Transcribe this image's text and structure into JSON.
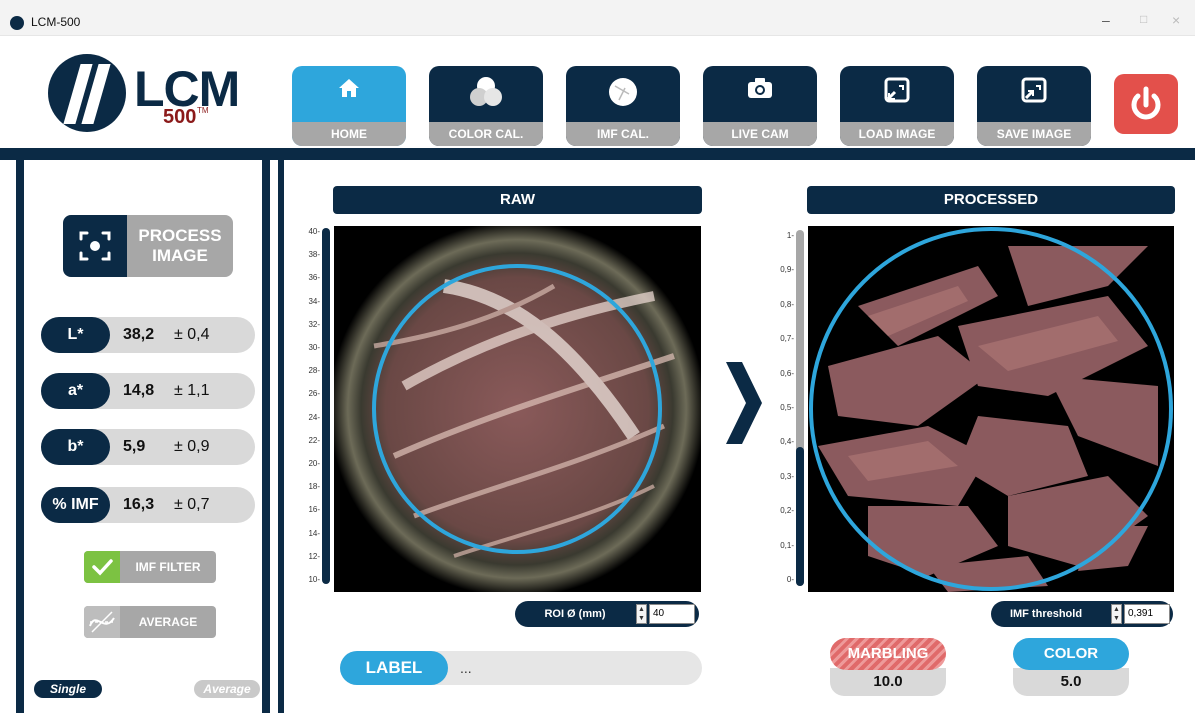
{
  "window": {
    "title": "LCM-500"
  },
  "logo": {
    "brand": "LCM",
    "model": "500",
    "tm": "TM"
  },
  "toolbar": {
    "home": "HOME",
    "color_cal": "COLOR CAL.",
    "imf_cal": "IMF CAL.",
    "live_cam": "LIVE CAM",
    "load_image": "LOAD IMAGE",
    "save_image": "SAVE IMAGE"
  },
  "left": {
    "process_line1": "PROCESS",
    "process_line2": "IMAGE",
    "measurements": [
      {
        "key": "L*",
        "value": "38,2",
        "pm": "± 0,4"
      },
      {
        "key": "a*",
        "value": "14,8",
        "pm": "± 1,1"
      },
      {
        "key": "b*",
        "value": "5,9",
        "pm": "± 0,9"
      },
      {
        "key": "% IMF",
        "value": "16,3",
        "pm": "± 0,7"
      }
    ],
    "imf_filter": "IMF FILTER",
    "average": "AVERAGE",
    "mode_single": "Single",
    "mode_average": "Average"
  },
  "raw": {
    "header": "RAW",
    "scale": [
      "40",
      "38",
      "36",
      "34",
      "32",
      "30",
      "28",
      "26",
      "24",
      "22",
      "20",
      "18",
      "16",
      "14",
      "12",
      "10"
    ],
    "roi_label": "ROI Ø (mm)",
    "roi_value": "40"
  },
  "processed": {
    "header": "PROCESSED",
    "scale": [
      "1",
      "0,9",
      "0,8",
      "0,7",
      "0,6",
      "0,5",
      "0,4",
      "0,3",
      "0,2",
      "0,1",
      "0"
    ],
    "threshold_label": "IMF threshold",
    "threshold_value": "0,391",
    "slider_level": 0.39
  },
  "label": {
    "key": "LABEL",
    "value": "..."
  },
  "results": {
    "marbling_label": "MARBLING",
    "marbling_value": "10.0",
    "color_label": "COLOR",
    "color_value": "5.0"
  },
  "colors": {
    "navy": "#0b2a45",
    "accent": "#2ea6dc",
    "power": "#e3504b",
    "gray": "#a7a7a7",
    "check": "#7cc242",
    "marbling": "#e06a6a"
  }
}
